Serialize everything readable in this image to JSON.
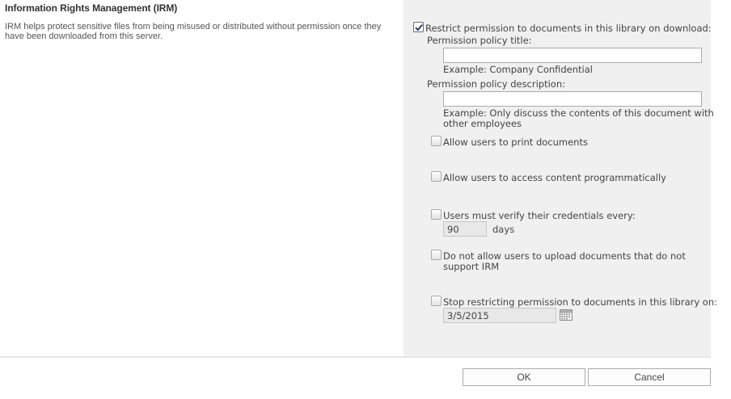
{
  "section": {
    "title": "Information Rights Management (IRM)",
    "description": "IRM helps protect sensitive files from being misused or distributed without permission once they have been downloaded from this server."
  },
  "restrict": {
    "label": "Restrict permission to documents in this library on download:",
    "checked": true
  },
  "policy_title": {
    "label": "Permission policy title:",
    "value": "",
    "example": "Example: Company Confidential"
  },
  "policy_description": {
    "label": "Permission policy description:",
    "value": "",
    "example_line1": "Example: Only discuss the contents of this document with",
    "example_line2": "other employees"
  },
  "options": {
    "print": {
      "label": "Allow users to print documents",
      "checked": false
    },
    "programmatic": {
      "label": "Allow users to access content programmatically",
      "checked": false
    },
    "verify": {
      "label": "Users must verify their credentials every:",
      "checked": false,
      "value": "90",
      "unit": "days"
    },
    "no_upload": {
      "label_line1": "Do not allow users to upload documents that do not",
      "label_line2": "support IRM",
      "checked": false
    },
    "stop": {
      "label": "Stop restricting permission to documents in this library on:",
      "checked": false,
      "date": "3/5/2015"
    }
  },
  "buttons": {
    "ok": "OK",
    "cancel": "Cancel"
  },
  "icons": {
    "checkmark": "checkmark-icon",
    "calendar": "calendar-icon"
  }
}
